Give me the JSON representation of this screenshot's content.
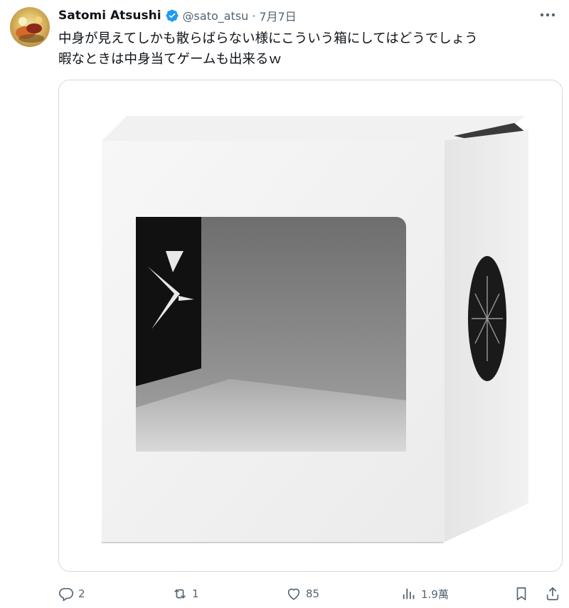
{
  "author": {
    "display_name": "Satomi Atsushi",
    "handle": "@sato_atsu",
    "date": "7月7日",
    "verified": true
  },
  "separator": "·",
  "tweet": {
    "lines": [
      "中身が見えてしかも散らばらない様にこういう箱にしてはどうでしょう",
      "暇なときは中身当てゲームも出来るｗ"
    ]
  },
  "media": {
    "alt": "white cardboard box with rectangular front window and round side window"
  },
  "actions": {
    "reply_count": "2",
    "retweet_count": "1",
    "like_count": "85",
    "view_count": "1.9萬"
  },
  "icons": {
    "avatar": "avatar-image",
    "verified": "verified-badge-icon",
    "more": "more-icon",
    "reply": "reply-icon",
    "retweet": "retweet-icon",
    "like": "heart-icon",
    "views": "views-icon",
    "bookmark": "bookmark-icon",
    "share": "share-icon"
  },
  "colors": {
    "text": "#0f1419",
    "secondary": "#536471",
    "verified": "#1d9bf0",
    "border": "#cfd9de"
  }
}
